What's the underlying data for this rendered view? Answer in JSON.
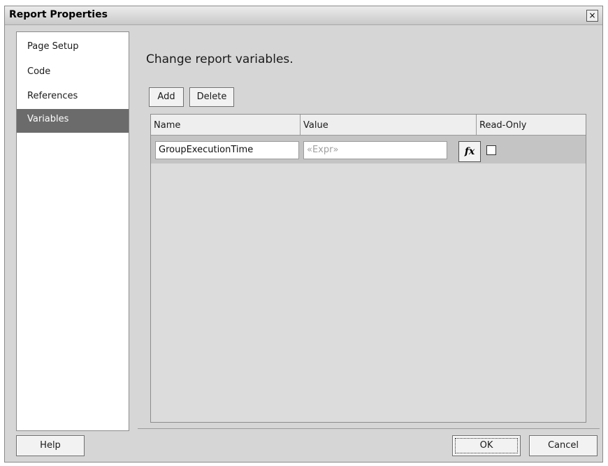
{
  "window": {
    "title": "Report Properties",
    "close_glyph": "×"
  },
  "nav": {
    "items": [
      {
        "label": "Page Setup",
        "selected": false
      },
      {
        "label": "Code",
        "selected": false
      },
      {
        "label": "References",
        "selected": false
      },
      {
        "label": "Variables",
        "selected": true
      }
    ]
  },
  "main": {
    "heading": "Change report variables.",
    "toolbar": {
      "add_label": "Add",
      "delete_label": "Delete"
    },
    "grid": {
      "columns": [
        "Name",
        "Value",
        "Read-Only"
      ],
      "rows": [
        {
          "name": "GroupExecutionTime",
          "value_placeholder": "«Expr»",
          "fx_label": "fx",
          "read_only": false
        }
      ]
    }
  },
  "footer": {
    "help_label": "Help",
    "ok_label": "OK",
    "cancel_label": "Cancel"
  }
}
